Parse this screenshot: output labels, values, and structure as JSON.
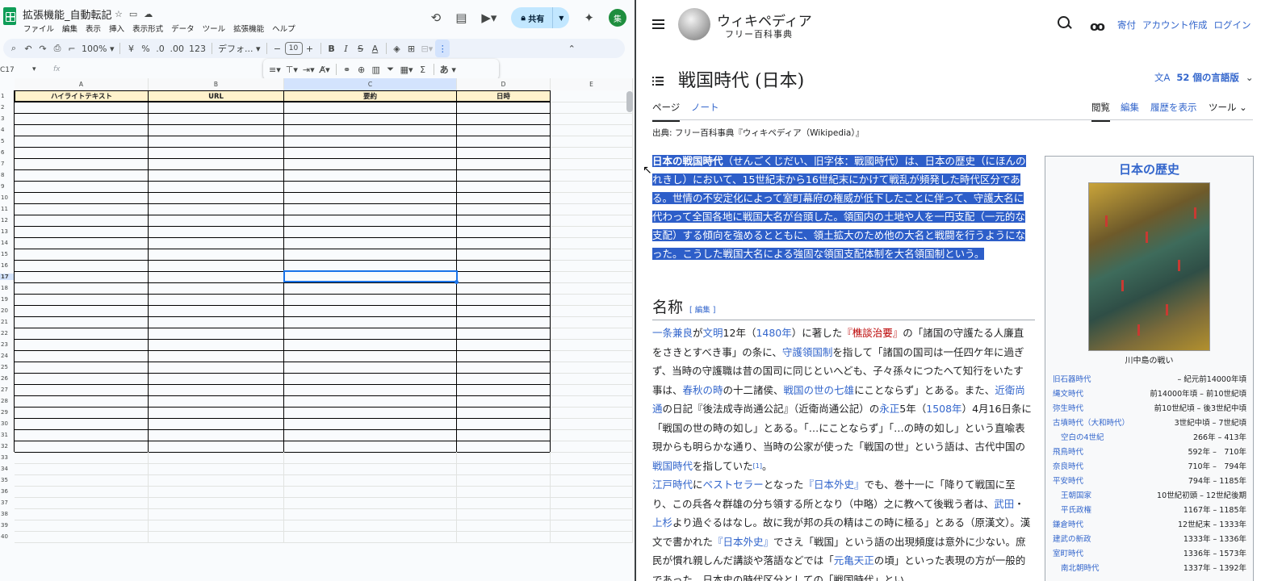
{
  "sheets": {
    "doc_title": "拡張機能_自動転記",
    "menus": [
      "ファイル",
      "編集",
      "表示",
      "挿入",
      "表示形式",
      "データ",
      "ツール",
      "拡張機能",
      "ヘルプ"
    ],
    "share_label": "共有",
    "avatar": "集",
    "toolbar": {
      "zoom": "100%",
      "currency": "¥",
      "percent": "%",
      "dec_less": ".0",
      "dec_more": ".00",
      "num_fmt": "123",
      "font": "デフォ...",
      "font_size": "10",
      "bold": "B",
      "italic": "I",
      "strike": "S",
      "text_color": "A",
      "input_lang": "あ"
    },
    "cell_ref": "C17",
    "fx": "fx",
    "columns": [
      "A",
      "B",
      "C",
      "D",
      "E"
    ],
    "headers": [
      "ハイライトテキスト",
      "URL",
      "要約",
      "日時"
    ],
    "rows": [
      "1",
      "2",
      "3",
      "4",
      "5",
      "6",
      "7",
      "8",
      "9",
      "10",
      "11",
      "12",
      "13",
      "14",
      "15",
      "16",
      "17",
      "18",
      "19",
      "20",
      "21",
      "22",
      "23",
      "24",
      "25",
      "26",
      "27",
      "28",
      "29",
      "30",
      "31",
      "32",
      "33",
      "34",
      "35",
      "36",
      "37",
      "38",
      "39",
      "40"
    ]
  },
  "wiki": {
    "wordmark": "ウィキペディア",
    "tagline": "フリー百科事典",
    "header_links": [
      "寄付",
      "アカウント作成",
      "ログイン"
    ],
    "title": "戦国時代 (日本)",
    "lang_count": "52 個の言語版",
    "tabs_left": [
      "ページ",
      "ノート"
    ],
    "tabs_right": [
      "閲覧",
      "編集",
      "履歴を表示",
      "ツール"
    ],
    "source": "出典: フリー百科事典『ウィキペディア（Wikipedia）』",
    "lead_bold": "日本の戦国時代",
    "lead_rest": "（せんごくじだい、旧字体：戰國時代）は、日本の歴史（にほんのれきし）において、15世紀末から16世紀末にかけて戦乱が頻発した時代区分である。世情の不安定化によって室町幕府の権威が低下したことに伴って、守護大名に代わって全国各地に戦国大名が台頭した。領国内の土地や人を一円支配（一元的な支配）する傾向を強めるとともに、領土拡大のため他の大名と戦闘を行うようになった。こうした戦国大名による強固な領国支配体制を大名領国制という。",
    "section_title": "名称",
    "section_edit": "[ 編集 ]",
    "p1": {
      "a": "一条兼良",
      "b": "が",
      "c": "文明",
      "d": "12年（",
      "e": "1480年",
      "f": "）に著した",
      "g": "『樵談治要』",
      "h": "の「諸国の守護たる人廉直をさきとすべき事」の条に、",
      "i": "守護領国制",
      "j": "を指して「諸国の国司は一任四ケ年に過ぎず、当時の守護職は昔の国司に同じといへども、子々孫々につたへて知行をいたす事は、",
      "k": "春秋の時",
      "l": "の十二諸侯、",
      "m": "戦国の世の七雄",
      "n": "にことならず」とある。また、",
      "o": "近衛尚通",
      "p": "の日記『後法成寺尚通公記』（近衛尚通公記）の",
      "q": "永正",
      "r": "5年（",
      "s": "1508年",
      "t": "）4月16日条に「戦国の世の時の如し」とある。「…にことならず」「…の時の如し」という直喩表現からも明らかな通り、当時の公家が使った「戦国の世」という語は、古代中国の",
      "u": "戦国時代",
      "v": "を指していた",
      "w": "[1]",
      "x": "。"
    },
    "p2": {
      "a": "江戸時代",
      "b": "に",
      "c": "ベストセラー",
      "d": "となった",
      "e": "『日本外史』",
      "f": "でも、巻十一に「降りて戦国に至り、この兵各々群雄の分ち領する所となり（中略）之に教へて後戦う者は、",
      "g": "武田",
      "h": "・",
      "i": "上杉",
      "j": "より過ぐるはなし。故に我が邦の兵の精はこの時に極る」とある（原漢文）。漢文で書かれた",
      "k": "『日本外史』",
      "l": "でさえ「戦国」という語の出現頻度は意外に少ない。庶民が慣れ親しんだ講談や落語などでは「",
      "m": "元亀天正",
      "n": "の頃」といった表現の方が一般的であった。日本史の時代区分としての「戦国時代」とい"
    },
    "infobox": {
      "title": "日本の歴史",
      "caption": "川中島の戦い",
      "rows": [
        {
          "name": "旧石器時代",
          "range": "– 紀元前14000年頃",
          "indent": false
        },
        {
          "name": "縄文時代",
          "range": "前14000年頃 – 前10世紀頃",
          "indent": false
        },
        {
          "name": "弥生時代",
          "range": "前10世紀頃 – 後3世紀中頃",
          "indent": false
        },
        {
          "name": "古墳時代（大和時代）",
          "range": "3世紀中頃 – 7世紀頃",
          "indent": false
        },
        {
          "name": "空白の4世紀",
          "range": "266年 – 413年",
          "indent": true
        },
        {
          "name": "飛鳥時代",
          "range": "592年 –　710年",
          "indent": false
        },
        {
          "name": "奈良時代",
          "range": "710年 –　794年",
          "indent": false
        },
        {
          "name": "平安時代",
          "range": "794年 – 1185年",
          "indent": false
        },
        {
          "name": "王朝国家",
          "range": "10世紀初頭 – 12世紀後期",
          "indent": true
        },
        {
          "name": "平氏政権",
          "range": "1167年 – 1185年",
          "indent": true
        },
        {
          "name": "鎌倉時代",
          "range": "12世紀末 – 1333年",
          "indent": false
        },
        {
          "name": "建武の新政",
          "range": "1333年 – 1336年",
          "indent": false
        },
        {
          "name": "室町時代",
          "range": "1336年 – 1573年",
          "indent": false
        },
        {
          "name": "南北朝時代",
          "range": "1337年 – 1392年",
          "indent": true
        }
      ]
    }
  },
  "colors": {
    "highlight": "#2d5ec9",
    "link": "#36c",
    "sheet_header_fill": "#fff2cc",
    "sheets_green": "#0f9d58"
  }
}
